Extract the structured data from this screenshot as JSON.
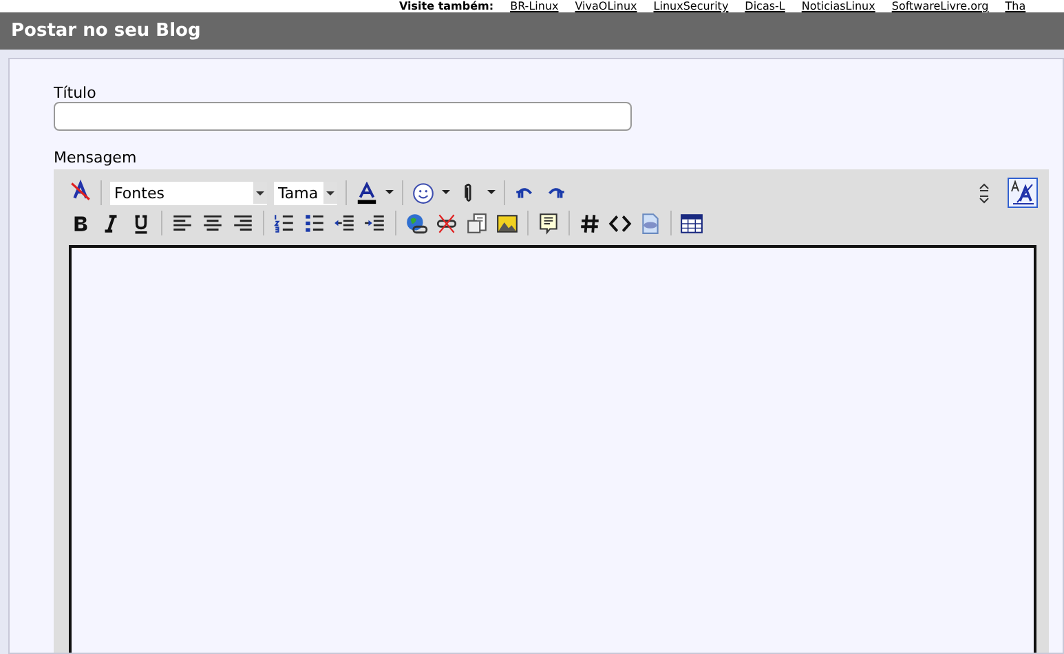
{
  "top_links": {
    "label": "Visite também:",
    "links": [
      "BR-Linux",
      "VivaOLinux",
      "LinuxSecurity",
      "Dicas-L",
      "NoticiasLinux",
      "SoftwareLivre.org",
      "Tha"
    ]
  },
  "header": {
    "title": "Postar no seu Blog"
  },
  "form": {
    "title_label": "Título",
    "message_label": "Mensagem"
  },
  "editor": {
    "font_select": "Fontes",
    "size_select": "Tama"
  }
}
